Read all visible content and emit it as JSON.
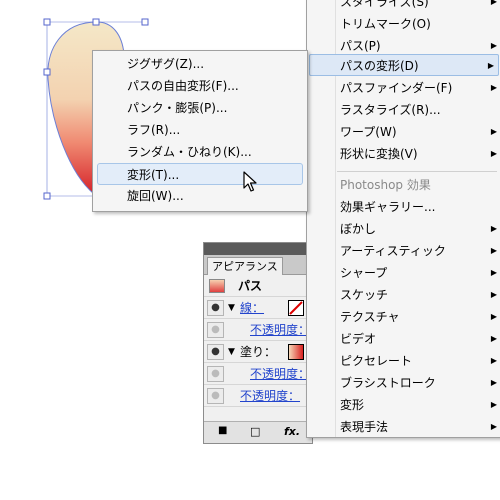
{
  "submenu": {
    "items": [
      {
        "label": "ジグザグ(Z)..."
      },
      {
        "label": "パスの自由変形(F)..."
      },
      {
        "label": "パンク・膨張(P)..."
      },
      {
        "label": "ラフ(R)..."
      },
      {
        "label": "ランダム・ひねり(K)..."
      },
      {
        "label": "変形(T)...",
        "highlighted": true
      },
      {
        "label": "旋回(W)..."
      }
    ]
  },
  "main_menu": {
    "items": [
      {
        "label": "スタイライズ(S)",
        "submenu": true
      },
      {
        "label": "トリムマーク(O)",
        "submenu": false
      },
      {
        "label": "パス(P)",
        "submenu": true
      },
      {
        "label": "パスの変形(D)",
        "submenu": true,
        "highlighted": true
      },
      {
        "label": "パスファインダー(F)",
        "submenu": true
      },
      {
        "label": "ラスタライズ(R)...",
        "submenu": false
      },
      {
        "label": "ワープ(W)",
        "submenu": true
      },
      {
        "label": "形状に変換(V)",
        "submenu": true
      }
    ],
    "section_header": "Photoshop 効果",
    "ps_items": [
      {
        "label": "効果ギャラリー...",
        "submenu": false
      },
      {
        "label": "ぼかし",
        "submenu": true
      },
      {
        "label": "アーティスティック",
        "submenu": true
      },
      {
        "label": "シャープ",
        "submenu": true
      },
      {
        "label": "スケッチ",
        "submenu": true
      },
      {
        "label": "テクスチャ",
        "submenu": true
      },
      {
        "label": "ビデオ",
        "submenu": true
      },
      {
        "label": "ピクセレート",
        "submenu": true
      },
      {
        "label": "ブラシストローク",
        "submenu": true
      },
      {
        "label": "変形",
        "submenu": true
      },
      {
        "label": "表現手法",
        "submenu": true
      }
    ]
  },
  "appearance_panel": {
    "tab_label": "アピアランス",
    "object_label": "パス",
    "stroke_label": "線：",
    "stroke_opacity_label": "不透明度：",
    "fill_label": "塗り：",
    "fill_opacity_label": "不透明度：",
    "object_opacity_label": "不透明度：",
    "fx_label": "fx."
  },
  "colors": {
    "highlight": "#dde8f6",
    "link": "#2244cc",
    "shape_top": "#f4e3c4",
    "shape_bottom": "#d82a2a"
  }
}
